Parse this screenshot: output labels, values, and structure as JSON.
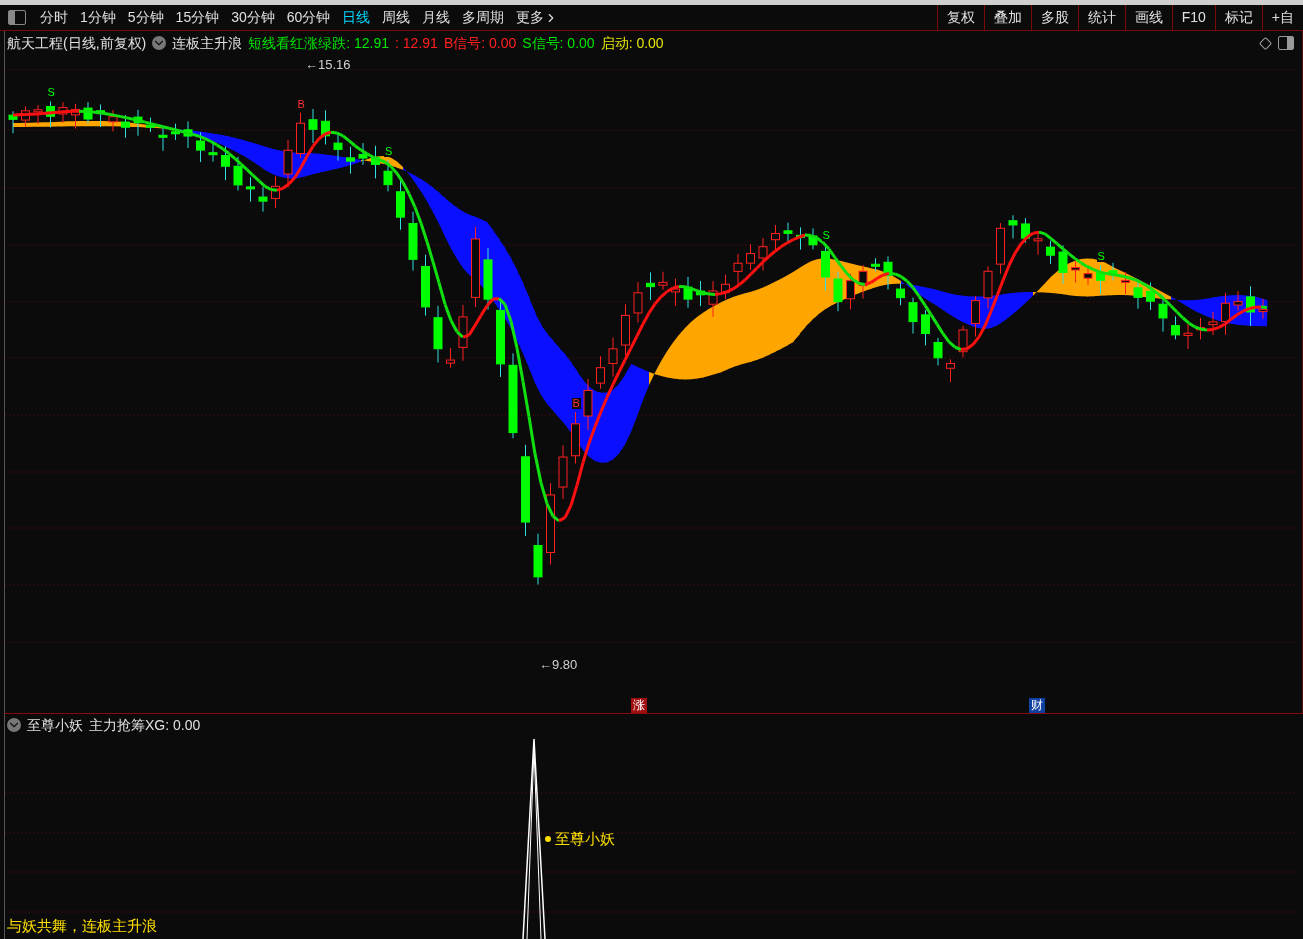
{
  "toolbar": {
    "periods": [
      {
        "label": "分时",
        "selected": false
      },
      {
        "label": "1分钟",
        "selected": false
      },
      {
        "label": "5分钟",
        "selected": false
      },
      {
        "label": "15分钟",
        "selected": false
      },
      {
        "label": "30分钟",
        "selected": false
      },
      {
        "label": "60分钟",
        "selected": false
      },
      {
        "label": "日线",
        "selected": true
      },
      {
        "label": "周线",
        "selected": false
      },
      {
        "label": "月线",
        "selected": false
      },
      {
        "label": "多周期",
        "selected": false
      }
    ],
    "more": "更多",
    "tools": [
      "复权",
      "叠加",
      "多股",
      "统计",
      "画线",
      "F10",
      "标记",
      "+自"
    ]
  },
  "main_panel": {
    "title": "航天工程(日线,前复权)",
    "indicator": "连板主升浪",
    "readings": [
      {
        "text": "短线看红涨绿跌: 12.91",
        "color": "#00e600"
      },
      {
        "text": ": 12.91",
        "color": "#ff2020"
      },
      {
        "text": "B信号: 0.00",
        "color": "#ff2020"
      },
      {
        "text": "S信号: 0.00",
        "color": "#00e600"
      },
      {
        "text": "启动: 0.00",
        "color": "#e6e600"
      }
    ],
    "high_label": "←15.16",
    "low_label": "←9.80",
    "signals": [
      {
        "text": "S"
      },
      {
        "text": "B"
      },
      {
        "text": "S"
      },
      {
        "text": "B"
      },
      {
        "text": "S"
      },
      {
        "text": "S"
      }
    ],
    "markers": [
      {
        "text": "涨",
        "color": "#a01010"
      },
      {
        "text": "财",
        "color": "#1040a0"
      }
    ]
  },
  "sub_panel": {
    "title": "至尊小妖",
    "indicator": "主力抢筹XG: 0.00",
    "signal_label": "至尊小妖"
  },
  "slogan": "与妖共舞，连板主升浪"
}
